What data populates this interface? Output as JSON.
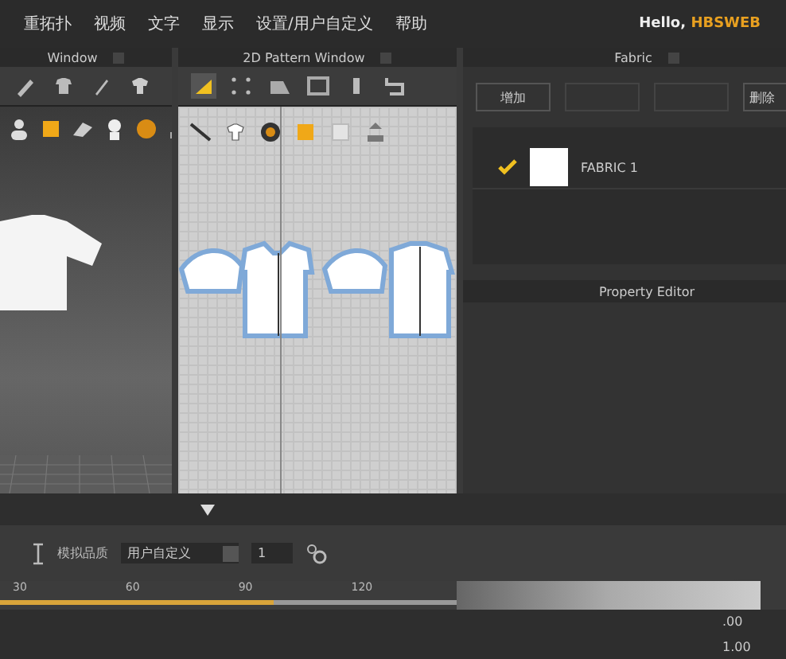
{
  "menu": [
    "重拓扑",
    "视频",
    "文字",
    "显示",
    "设置/用户自定义",
    "帮助"
  ],
  "user": {
    "greeting": "Hello,",
    "name": "HBSWEB"
  },
  "avatar_window": {
    "title": "Window"
  },
  "pattern_window": {
    "title": "2D Pattern Window"
  },
  "fabric_panel": {
    "title": "Fabric",
    "buttons": [
      {
        "label": "增加",
        "disabled": false
      },
      {
        "disabled": true
      },
      {
        "disabled": true
      },
      {
        "label": "删除",
        "disabled": false
      }
    ],
    "fabrics": [
      {
        "name": "FABRIC 1",
        "checked": true
      }
    ]
  },
  "property_editor": {
    "title": "Property Editor"
  },
  "simulation": {
    "label": "模拟品质",
    "quality": "用户自定义",
    "step": "1"
  },
  "timeline": {
    "ticks": [
      "30",
      "60",
      "90",
      "120"
    ],
    "level": 0.6
  },
  "values": [
    ".00",
    "1.00"
  ]
}
